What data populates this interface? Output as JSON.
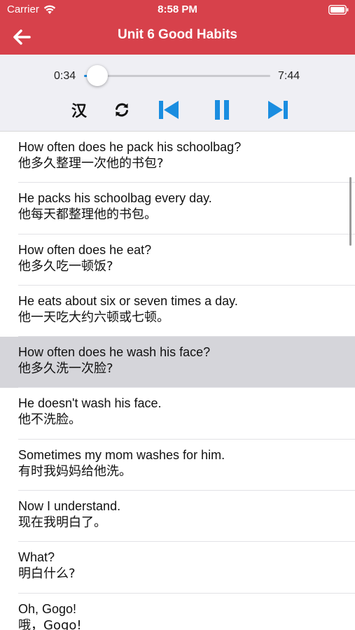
{
  "status_bar": {
    "carrier": "Carrier",
    "time": "8:58 PM"
  },
  "nav": {
    "title": "Unit 6 Good Habits"
  },
  "player": {
    "current_time": "0:34",
    "total_time": "7:44",
    "progress": 0.073,
    "hanzi_toggle": "汉",
    "icons": [
      "repeat-icon",
      "skip-previous-icon",
      "pause-icon",
      "skip-next-icon"
    ]
  },
  "colors": {
    "header": "#d7414b",
    "accent": "#1a8de0",
    "selected_row": "#d5d5da"
  },
  "sentences": [
    {
      "en": "How often does he pack his schoolbag?",
      "zh": "他多久整理一次他的书包?"
    },
    {
      "en": "He packs his schoolbag every day.",
      "zh": "他每天都整理他的书包。"
    },
    {
      "en": "How often does he eat?",
      "zh": "他多久吃一顿饭?"
    },
    {
      "en": "He eats about six or seven times a day.",
      "zh": "他一天吃大约六顿或七顿。"
    },
    {
      "en": "How often does he wash his face?",
      "zh": "他多久洗一次脸?"
    },
    {
      "en": "He doesn't wash his face.",
      "zh": "他不洗脸。"
    },
    {
      "en": "Sometimes my mom washes for him.",
      "zh": "有时我妈妈给他洗。"
    },
    {
      "en": "Now I understand.",
      "zh": "现在我明白了。"
    },
    {
      "en": "What?",
      "zh": "明白什么?"
    },
    {
      "en": "Oh, Gogo!",
      "zh": "哦，Gogo!"
    }
  ],
  "selected_index": 4
}
